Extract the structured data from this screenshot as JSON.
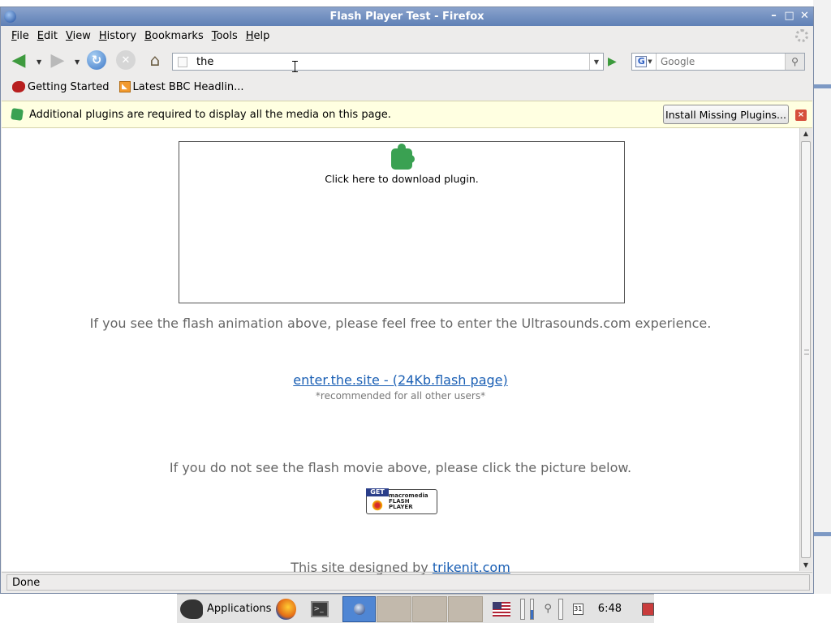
{
  "window": {
    "title": "Flash Player Test - Firefox",
    "controls": [
      "–",
      "□",
      "✕"
    ]
  },
  "menubar": {
    "items": [
      "File",
      "Edit",
      "View",
      "History",
      "Bookmarks",
      "Tools",
      "Help"
    ]
  },
  "navigation": {
    "url_value": "the",
    "search_placeholder": "Google",
    "search_engine_letter": "G"
  },
  "bookmarks": {
    "items": [
      "Getting Started",
      "Latest BBC Headlin..."
    ]
  },
  "notification": {
    "message": "Additional plugins are required to display all the media on this page.",
    "install_label": "Install Missing Plugins...",
    "close_glyph": "×"
  },
  "page": {
    "plugin_prompt": "Click here to download plugin.",
    "line1": "If you see the flash animation above, please feel free to enter the Ultrasounds.com experience.",
    "enter_link": "enter.the.site - (24Kb.flash page)",
    "recommend": "*recommended for all other users*",
    "line2": "If you do not see the flash movie above, please click the picture below.",
    "flash_badge": {
      "get": "GET",
      "brand": "macromedia",
      "product": "FLASH",
      "player": "PLAYER"
    },
    "footer_prefix": "This site designed by ",
    "footer_link": "trikenit.com"
  },
  "statusbar": {
    "text": "Done"
  },
  "taskbar": {
    "applications_label": "Applications",
    "calendar_day": "31",
    "clock": "6:48",
    "terminal_prompt": ">_"
  },
  "colors": {
    "titlebar": "#6f8dc0",
    "notification_bg": "#ffffe1",
    "link": "#1a5fb4",
    "active_task": "#4f86d4"
  },
  "icons": [
    "firefox-icon",
    "back-arrow-icon",
    "forward-arrow-icon",
    "reload-icon",
    "stop-icon",
    "home-icon",
    "go-arrow-icon",
    "google-icon",
    "magnifier-icon",
    "puzzle-plugin-icon",
    "rss-feed-icon",
    "flash-player-badge"
  ]
}
